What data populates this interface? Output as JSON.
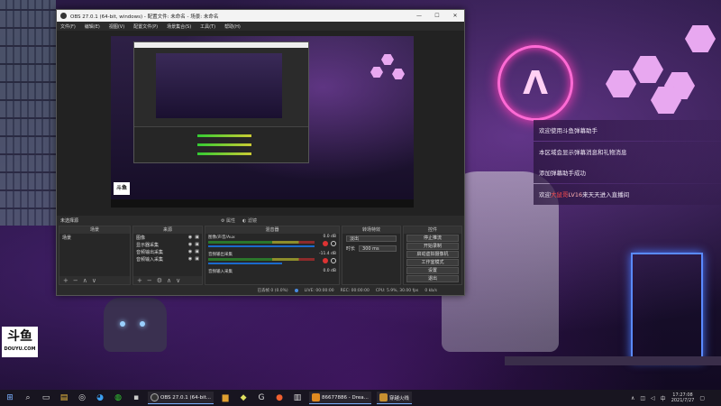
{
  "obs": {
    "title": "OBS 27.0.1 (64-bit, windows) - 配置文件: 未命名 - 场景: 未命名",
    "menu": [
      "文件(F)",
      "编辑(E)",
      "视图(V)",
      "配置文件(P)",
      "场景集合(S)",
      "工具(T)",
      "帮助(H)"
    ],
    "window_buttons": [
      "—",
      "☐",
      "✕"
    ],
    "filter_bar": {
      "label": "未选择源",
      "properties": "属性",
      "filters": "滤镜"
    },
    "docks": {
      "scenes": {
        "title": "场景",
        "items": [
          "场景"
        ]
      },
      "sources": {
        "title": "来源",
        "items": [
          "图像",
          "显示器采集",
          "音频输出采集",
          "音频输入采集"
        ]
      },
      "mixer": {
        "title": "混音器",
        "rows": [
          {
            "name": "图像/声音/Aux",
            "db": "0.0 dB"
          },
          {
            "name": "音频输出采集",
            "db": "-11.4 dB"
          },
          {
            "name": "音频输入采集",
            "db": "0.0 dB"
          }
        ]
      },
      "transitions": {
        "title": "转场特效",
        "effect": "淡出",
        "duration_label": "时长",
        "duration": "300 ms"
      },
      "controls": {
        "title": "控件",
        "buttons": [
          "停止推流",
          "开始录制",
          "启动虚拟摄像机",
          "工作室模式",
          "设置",
          "退出"
        ]
      }
    },
    "status": {
      "live": "LIVE: 00:00:00",
      "rec": "REC: 00:00:00",
      "cpu": "CPU: 5.9%, 30.00 fps",
      "drop": "已丢帧 0 (0.0%)",
      "kbps": "0 kb/s"
    }
  },
  "chat": {
    "messages": [
      {
        "text": "欢迎使用斗鱼弹幕助手"
      },
      {
        "text": "本区域会显示弹幕消息和礼物消息"
      },
      {
        "text": "添加弹幕助手成功"
      },
      {
        "prefix": "欢迎",
        "highlight": "大鼠哥",
        "level": "LV16",
        "suffix": "来天天进入直播间"
      }
    ]
  },
  "douyu": {
    "logo": "斗鱼",
    "domain": "DOUYU.COM"
  },
  "taskbar": {
    "tasks": [
      {
        "label": "OBS 27.0.1 (64-bit...",
        "color": "#333333"
      },
      {
        "label": "86677886 - Drea...",
        "color": "#e08a20"
      },
      {
        "label": "穿越火线",
        "color": "#c89030"
      }
    ],
    "time": "17:27:08",
    "date": "2021/7/27"
  },
  "colors": {
    "accent_pink": "#ff6ad5",
    "hex_fill": "#e8a8f0",
    "meter_blue": "#1a6acc"
  }
}
